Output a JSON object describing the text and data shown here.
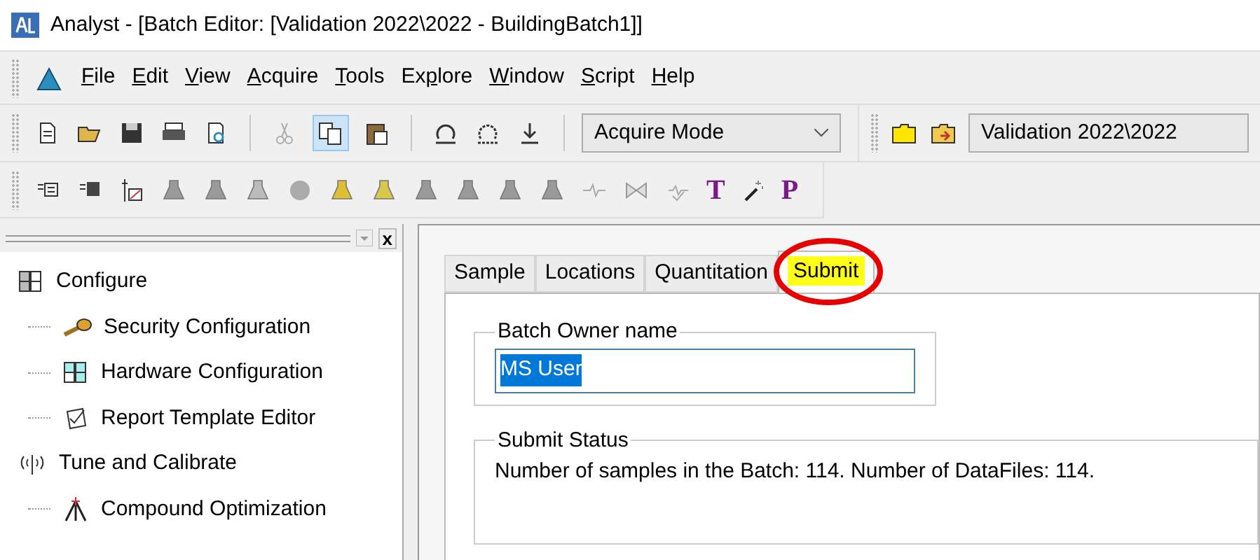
{
  "window": {
    "title": "Analyst - [Batch Editor: [Validation 2022\\2022 - BuildingBatch1]]"
  },
  "menu": [
    {
      "key": "F",
      "after": "ile"
    },
    {
      "key": "E",
      "after": "dit"
    },
    {
      "key": "V",
      "after": "iew"
    },
    {
      "key": "A",
      "after": "cquire"
    },
    {
      "key": "T",
      "after": "ools"
    },
    {
      "before": "Ex",
      "key": "p",
      "after": "lore"
    },
    {
      "key": "W",
      "after": "indow"
    },
    {
      "key": "S",
      "after": "cript"
    },
    {
      "key": "H",
      "after": "elp"
    }
  ],
  "toolbar": {
    "mode_select": {
      "value": "Acquire Mode"
    },
    "project_select": {
      "value": "Validation 2022\\2022"
    },
    "copy_pressed": true
  },
  "toolbar2": {
    "text_tool": "T",
    "p_tool": "P"
  },
  "navigator": {
    "close": "x",
    "groups": [
      {
        "label": "Configure",
        "children": [
          {
            "label": "Security Configuration"
          },
          {
            "label": "Hardware Configuration"
          },
          {
            "label": "Report Template Editor"
          }
        ]
      },
      {
        "label": "Tune and Calibrate",
        "children": [
          {
            "label": "Compound Optimization"
          }
        ]
      }
    ]
  },
  "tabs": [
    {
      "label": "Sample",
      "selected": false,
      "highlighted": false
    },
    {
      "label": "Locations",
      "selected": false,
      "highlighted": false
    },
    {
      "label": "Quantitation",
      "selected": false,
      "highlighted": false
    },
    {
      "label": "Submit",
      "selected": true,
      "highlighted": true
    }
  ],
  "owner": {
    "legend": "Batch Owner name",
    "value": "MS User",
    "text_selected": true
  },
  "status": {
    "legend": "Submit Status",
    "text": "Number of samples in the Batch: 114. Number of DataFiles: 114."
  }
}
